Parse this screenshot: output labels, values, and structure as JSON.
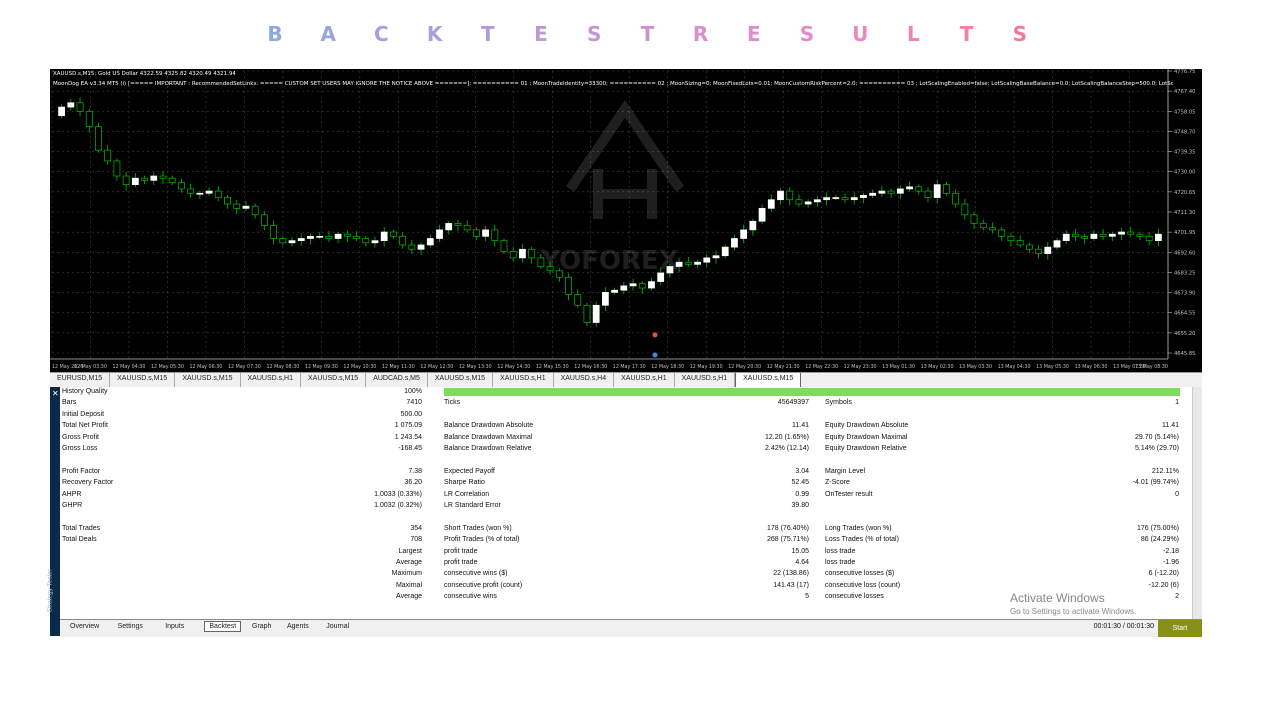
{
  "banner": {
    "letters": [
      "B",
      "A",
      "C",
      "K",
      "T",
      "E",
      "S",
      "T",
      "R",
      "E",
      "S",
      "U",
      "L",
      "T",
      "S"
    ],
    "colors": [
      "#8fa8dd",
      "#98a5dc",
      "#a0a2da",
      "#a99fd8",
      "#b29cd6",
      "#bb99d4",
      "#c496d2",
      "#cc93cf",
      "#d590cd",
      "#de8dcb",
      "#e68ac8",
      "#ec86bf",
      "#ef83b3",
      "#f080a6",
      "#f07b98"
    ]
  },
  "chart": {
    "symbol_line": "XAUUSD.s,M15:  Gold US Dollar  4322.59 4325.82 4320.49 4321.94",
    "ea_line": "MoonDog EA v3.34 MT5 (i) [===== IMPORTANT : RecommendedSetLinks: ===== CUSTOM SET USERS MAY IGNORE THE NOTICE ABOVE =======]; ========== 01 ; MoonTradeIdentity=33300; ========== 02 ; MoonSizing=0; MoonFixedLots=0.01; MoonCustomRiskPercent=2.0; ========== 03 ; LotScalingEnabled=false; LotScalingBaseBalance=0.0; LotScalingBalanceStep=500.0; LotScalingLotStep=0.01; LotScalingMaxLots=0.0",
    "watermark": "YOFOREX",
    "price_labels": [
      "4776.75",
      "4767.40",
      "4758.05",
      "4748.70",
      "4739.35",
      "4730.00",
      "4720.65",
      "4711.30",
      "4701.95",
      "4692.60",
      "4683.25",
      "4673.90",
      "4664.55",
      "4655.20",
      "4645.85"
    ],
    "time_labels": [
      "12 May 2026",
      "12 May 03:30",
      "12 May 04:30",
      "12 May 05:30",
      "12 May 06:30",
      "12 May 07:30",
      "12 May 08:30",
      "12 May 09:30",
      "12 May 10:30",
      "12 May 11:30",
      "12 May 12:30",
      "12 May 13:30",
      "12 May 14:30",
      "12 May 15:30",
      "12 May 16:30",
      "12 May 17:30",
      "12 May 18:30",
      "12 May 19:30",
      "12 May 20:30",
      "12 May 21:30",
      "12 May 22:30",
      "12 May 23:30",
      "13 May 01:30",
      "13 May 02:30",
      "13 May 03:30",
      "13 May 04:30",
      "13 May 05:30",
      "13 May 06:30",
      "13 May 07:30",
      "13 May 08:30"
    ],
    "closes": [
      4760,
      4762,
      4758,
      4751,
      4740,
      4735,
      4728,
      4724,
      4727,
      4726,
      4728,
      4727,
      4725,
      4722,
      4720,
      4720,
      4721,
      4718,
      4715,
      4713,
      4714,
      4710,
      4705,
      4699,
      4697,
      4698,
      4699,
      4700,
      4700,
      4699,
      4701,
      4700,
      4699,
      4697,
      4698,
      4702,
      4700,
      4696,
      4694,
      4696,
      4699,
      4703,
      4706,
      4705,
      4703,
      4700,
      4703,
      4698,
      4693,
      4690,
      4694,
      4690,
      4686,
      4684,
      4681,
      4673,
      4668,
      4660,
      4668,
      4674,
      4675,
      4677,
      4678,
      4676,
      4679,
      4683,
      4686,
      4688,
      4687,
      4688,
      4690,
      4691,
      4695,
      4699,
      4703,
      4707,
      4713,
      4717,
      4721,
      4717,
      4715,
      4716,
      4717,
      4718,
      4718,
      4717,
      4718,
      4719,
      4720,
      4721,
      4720,
      4722,
      4723,
      4721,
      4718,
      4724,
      4720,
      4715,
      4710,
      4706,
      4704,
      4703,
      4700,
      4698,
      4696,
      4694,
      4692,
      4695,
      4698,
      4701,
      4700,
      4699,
      4701,
      4700,
      4701,
      4702,
      4701,
      4700,
      4698,
      4701
    ],
    "colors": {
      "bull": "#ffffff",
      "bear": "#00c000",
      "grid": "#3a4a3a",
      "axis": "#c0c0c0"
    }
  },
  "symbol_tabs": [
    "EURUSD,M15",
    "XAUUSD.s,M15",
    "XAUUSD.s,M15",
    "XAUUSD.s,H1",
    "XAUUSD.s,M15",
    "AUDCAD.s,M5",
    "XAUUSD.s,M15",
    "XAUUSD.s,H1",
    "XAUUSD.s,H4",
    "XAUUSD.s,H1",
    "XAUUSD.s,H1",
    "XAUUSD.s,M15"
  ],
  "active_tab_index": 11,
  "tester": {
    "side_label": "Strategy Tester",
    "col1": [
      {
        "label": "History Quality",
        "value": "100%"
      },
      {
        "label": "Bars",
        "value": "7410"
      },
      {
        "label": "Initial Deposit",
        "value": "500.00"
      },
      {
        "label": "Total Net Profit",
        "value": "1 075.09"
      },
      {
        "label": "Gross Profit",
        "value": "1 243.54"
      },
      {
        "label": "Gross Loss",
        "value": "-168.45"
      },
      {
        "label": "",
        "value": ""
      },
      {
        "label": "Profit Factor",
        "value": "7.38"
      },
      {
        "label": "Recovery Factor",
        "value": "36.20"
      },
      {
        "label": "AHPR",
        "value": "1.0033 (0.33%)"
      },
      {
        "label": "GHPR",
        "value": "1.0032 (0.32%)"
      },
      {
        "label": "",
        "value": ""
      },
      {
        "label": "Total Trades",
        "value": "354"
      },
      {
        "label": "Total Deals",
        "value": "708"
      },
      {
        "label": "",
        "value": "Largest"
      },
      {
        "label": "",
        "value": "Average"
      },
      {
        "label": "",
        "value": "Maximum"
      },
      {
        "label": "",
        "value": "Maximal"
      },
      {
        "label": "",
        "value": "Average"
      }
    ],
    "col2": [
      {
        "label": "",
        "value": ""
      },
      {
        "label": "Ticks",
        "value": "45649397"
      },
      {
        "label": "",
        "value": ""
      },
      {
        "label": "Balance Drawdown Absolute",
        "value": "11.41"
      },
      {
        "label": "Balance Drawdown Maximal",
        "value": "12.20 (1.65%)"
      },
      {
        "label": "Balance Drawdown Relative",
        "value": "2.42% (12.14)"
      },
      {
        "label": "",
        "value": ""
      },
      {
        "label": "Expected Payoff",
        "value": "3.04"
      },
      {
        "label": "Sharpe Ratio",
        "value": "52.45"
      },
      {
        "label": "LR Correlation",
        "value": "0.99"
      },
      {
        "label": "LR Standard Error",
        "value": "39.80"
      },
      {
        "label": "",
        "value": ""
      },
      {
        "label": "Short Trades (won %)",
        "value": "178 (76.40%)"
      },
      {
        "label": "Profit Trades (% of total)",
        "value": "268 (75.71%)"
      },
      {
        "label": "profit trade",
        "value": "15.05"
      },
      {
        "label": "profit trade",
        "value": "4.64"
      },
      {
        "label": "consecutive wins ($)",
        "value": "22 (138.86)"
      },
      {
        "label": "consecutive profit (count)",
        "value": "141.43 (17)"
      },
      {
        "label": "consecutive wins",
        "value": "5"
      }
    ],
    "col3": [
      {
        "label": "",
        "value": ""
      },
      {
        "label": "Symbols",
        "value": "1"
      },
      {
        "label": "",
        "value": ""
      },
      {
        "label": "Equity Drawdown Absolute",
        "value": "11.41"
      },
      {
        "label": "Equity Drawdown Maximal",
        "value": "29.70 (5.14%)"
      },
      {
        "label": "Equity Drawdown Relative",
        "value": "5.14% (29.70)"
      },
      {
        "label": "",
        "value": ""
      },
      {
        "label": "Margin Level",
        "value": "212.11%"
      },
      {
        "label": "Z-Score",
        "value": "-4.01 (99.74%)"
      },
      {
        "label": "OnTester result",
        "value": "0"
      },
      {
        "label": "",
        "value": ""
      },
      {
        "label": "",
        "value": ""
      },
      {
        "label": "Long Trades (won %)",
        "value": "176 (75.00%)"
      },
      {
        "label": "Loss Trades (% of total)",
        "value": "86 (24.29%)"
      },
      {
        "label": "loss trade",
        "value": "-2.18"
      },
      {
        "label": "loss trade",
        "value": "-1.96"
      },
      {
        "label": "consecutive losses ($)",
        "value": "6 (-12.20)"
      },
      {
        "label": "consecutive loss (count)",
        "value": "-12.20 (6)"
      },
      {
        "label": "consecutive losses",
        "value": "2"
      }
    ],
    "quality_bar_color": "#7ddc5e",
    "quality_fraction": 1.0,
    "bottom_tabs": [
      "Overview",
      "Settings",
      "Inputs",
      "Backtest",
      "Graph",
      "Agents",
      "Journal"
    ],
    "active_bottom_tab": "Backtest",
    "timer": "00:01:30 / 00:01:30",
    "start_label": "Start",
    "activate_title": "Activate Windows",
    "activate_sub": "Go to Settings to activate Windows."
  }
}
